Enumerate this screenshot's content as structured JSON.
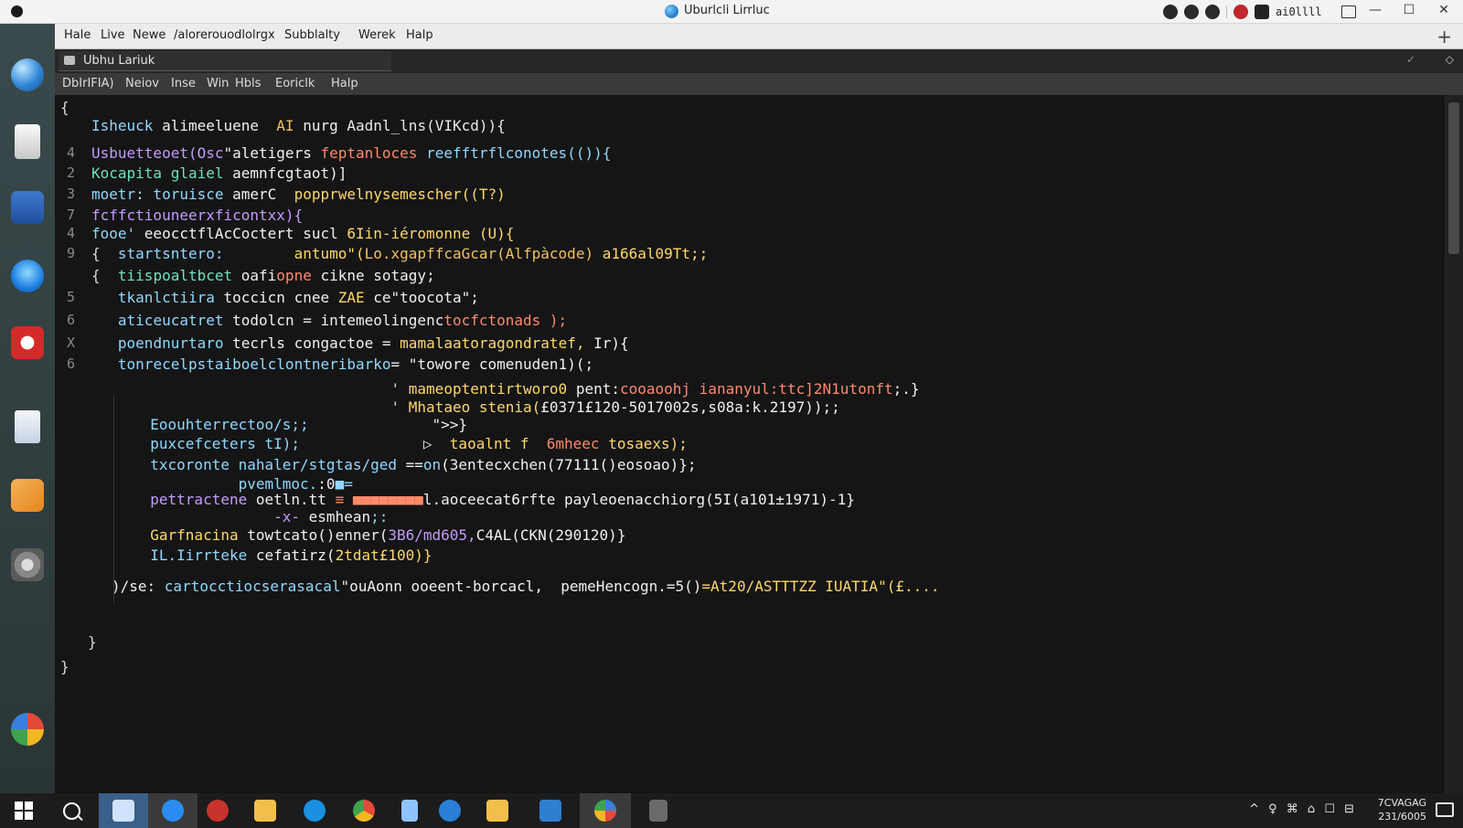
{
  "window": {
    "title": "Uburlcli Lirrluc",
    "user": "ai0llll"
  },
  "menubar": {
    "items": [
      "Hale",
      "Live",
      "Newe",
      "/alorerouodlolrgx",
      "Subblalty",
      "Werek",
      "Halp"
    ]
  },
  "tab": {
    "label": "Ubhu Lariuk"
  },
  "submenu": {
    "items": [
      "DbIrIFIA)",
      "Neiov",
      "Inse",
      "Win",
      "Hbls",
      "Eoriclk",
      "Halp"
    ]
  },
  "code": {
    "gutter": [
      "4",
      "2",
      "3",
      "7",
      "4",
      "9",
      "5",
      "6",
      "X",
      "6"
    ],
    "lines": [
      {
        "segments": [
          {
            "t": "{",
            "c": "#d8d8d8"
          }
        ]
      },
      {
        "segments": [
          {
            "t": "Ishеuсk ",
            "c": "#8fd8ff"
          },
          {
            "t": "alimeeluene  ",
            "c": "#f0f0f0"
          },
          {
            "t": "AI ",
            "c": "#f0c060"
          },
          {
            "t": "nurg ",
            "c": "#f0f0f0"
          },
          {
            "t": "Aadnl_lns(VIKcd)){",
            "c": "#e8e8e8"
          }
        ]
      },
      {
        "segments": [
          {
            "t": "Usbuetteoet(Osc",
            "c": "#c49bff"
          },
          {
            "t": "\"aletigers ",
            "c": "#f0f0f0"
          },
          {
            "t": "feptanloces ",
            "c": "#ff8a6a"
          },
          {
            "t": "reefftrflconotes(()){",
            "c": "#8fd8ff"
          }
        ]
      },
      {
        "segments": [
          {
            "t": "Kocapita glaiel ",
            "c": "#6fe0c0"
          },
          {
            "t": "aemnfcgtaot)]",
            "c": "#f0f0f0"
          }
        ]
      },
      {
        "segments": [
          {
            "t": "moetr: toruisce ",
            "c": "#8fd8ff"
          },
          {
            "t": "amerC  ",
            "c": "#f0f0f0"
          },
          {
            "t": "popprwelnysemescher((T?)",
            "c": "#ffd86a"
          }
        ]
      },
      {
        "segments": [
          {
            "t": "fcffctiouneerxficontxx){",
            "c": "#c49bff"
          }
        ]
      },
      {
        "segments": [
          {
            "t": "fooe' ",
            "c": "#8fd8ff"
          },
          {
            "t": "eeocctflAcCoctert sucl ",
            "c": "#f0f0f0"
          },
          {
            "t": "6Iin-iéromonne (U){",
            "c": "#ffd86a"
          }
        ]
      },
      {
        "segments": [
          {
            "t": "{  ",
            "c": "#d8d8d8"
          },
          {
            "t": "startsntero:        ",
            "c": "#8fd8ff"
          },
          {
            "t": "antumo\"(",
            "c": "#ffd86a"
          },
          {
            "t": "Lo.xgapffcaGcar(Alfpàcode) ",
            "c": "#f0c060"
          },
          {
            "t": "a166al09Tt;;",
            "c": "#ffd86a"
          }
        ]
      },
      {
        "segments": [
          {
            "t": "{  ",
            "c": "#d8d8d8"
          },
          {
            "t": "tiispoaltbcet ",
            "c": "#6fe0c0"
          },
          {
            "t": "oafi",
            "c": "#f0f0f0"
          },
          {
            "t": "opne ",
            "c": "#ff8a6a"
          },
          {
            "t": "cikne sotagy;",
            "c": "#f0f0f0"
          }
        ]
      },
      {
        "segments": [
          {
            "t": "   ",
            "c": "#d8d8d8"
          },
          {
            "t": "tkanlctiira ",
            "c": "#8fd8ff"
          },
          {
            "t": "toccicn cnee ",
            "c": "#f0f0f0"
          },
          {
            "t": "ZAE ",
            "c": "#ffd86a"
          },
          {
            "t": "ce\"toocota\";",
            "c": "#f0f0f0"
          }
        ]
      },
      {
        "segments": [
          {
            "t": "   ",
            "c": "#d8d8d8"
          },
          {
            "t": "aticeucatret ",
            "c": "#8fd8ff"
          },
          {
            "t": "todolcn = ",
            "c": "#f0f0f0"
          },
          {
            "t": "intemeolingenc",
            "c": "#f0f0f0"
          },
          {
            "t": "tocfctonads );",
            "c": "#ff8a6a"
          }
        ]
      },
      {
        "segments": [
          {
            "t": "   ",
            "c": "#d8d8d8"
          },
          {
            "t": "poendnurtaro ",
            "c": "#8fd8ff"
          },
          {
            "t": "tecrls congactoe = ",
            "c": "#f0f0f0"
          },
          {
            "t": "mamalaatoragondratef, ",
            "c": "#ffd86a"
          },
          {
            "t": "Ir){",
            "c": "#f0f0f0"
          }
        ]
      },
      {
        "segments": [
          {
            "t": "   ",
            "c": "#d8d8d8"
          },
          {
            "t": "tonrecelpstaiboelclontneribarko",
            "c": "#8fd8ff"
          },
          {
            "t": "= \"towore comenuden1)(;",
            "c": "#f0f0f0"
          }
        ]
      },
      {
        "segments": [
          {
            "t": "                                  ' ",
            "c": "#d8d8d8"
          },
          {
            "t": "mameoptentirtworo0 ",
            "c": "#ffd86a"
          },
          {
            "t": "pent:",
            "c": "#f0f0f0"
          },
          {
            "t": "cooaoohj iananyul:ttc]2N1utonft",
            "c": "#ff8a6a"
          },
          {
            "t": ";.}",
            "c": "#f0f0f0"
          }
        ]
      },
      {
        "segments": [
          {
            "t": "                                  ' ",
            "c": "#d8d8d8"
          },
          {
            "t": "Mhataeo stenia(",
            "c": "#ffd86a"
          },
          {
            "t": "£0371£120-5017002s,s08a:k.2197));;",
            "c": "#f0f0f0"
          }
        ]
      },
      {
        "segments": [
          {
            "t": "  ",
            "c": "#d8d8d8"
          },
          {
            "t": "Eoouhterrectoo/s;;",
            "c": "#8fd8ff"
          },
          {
            "t": "              \">>}",
            "c": "#f0f0f0"
          }
        ]
      },
      {
        "segments": [
          {
            "t": "  ",
            "c": "#d8d8d8"
          },
          {
            "t": "puxcefceters tI);",
            "c": "#8fd8ff"
          },
          {
            "t": "              ▷  ",
            "c": "#f0f0f0"
          },
          {
            "t": "taoalnt f  ",
            "c": "#ffd86a"
          },
          {
            "t": "6mheec ",
            "c": "#ff8a6a"
          },
          {
            "t": "tosaexs);",
            "c": "#ffd86a"
          }
        ]
      },
      {
        "segments": [
          {
            "t": "  ",
            "c": "#d8d8d8"
          },
          {
            "t": "txcoronte nahaler/stgtas/ged ",
            "c": "#8fd8ff"
          },
          {
            "t": "==",
            "c": "#f0f0f0"
          },
          {
            "t": "on",
            "c": "#8fd8ff"
          },
          {
            "t": "(3entecxchen(77111()eosoao)};",
            "c": "#f0f0f0"
          }
        ]
      },
      {
        "segments": [
          {
            "t": "            ",
            "c": "#d8d8d8"
          },
          {
            "t": "pvemlmoc.",
            "c": "#8fd8ff"
          },
          {
            "t": ":0",
            "c": "#f0f0f0"
          },
          {
            "t": "■=",
            "c": "#8fd8ff"
          }
        ]
      },
      {
        "segments": [
          {
            "t": "  ",
            "c": "#d8d8d8"
          },
          {
            "t": "pettractene ",
            "c": "#c49bff"
          },
          {
            "t": "oetln.tt ",
            "c": "#f0f0f0"
          },
          {
            "t": "≡ ■■■■■■■■",
            "c": "#ff8a6a"
          },
          {
            "t": "l.aoceecat6rfte payleoenacchiorg(5I(a101±1971)-1}",
            "c": "#f0f0f0"
          }
        ]
      },
      {
        "segments": [
          {
            "t": "                ",
            "c": "#d8d8d8"
          },
          {
            "t": "-x- ",
            "c": "#c49bff"
          },
          {
            "t": "esmhean",
            "c": "#f0f0f0"
          },
          {
            "t": ";:",
            "c": "#8fd8ff"
          }
        ]
      },
      {
        "segments": [
          {
            "t": "  ",
            "c": "#d8d8d8"
          },
          {
            "t": "Garfnacina ",
            "c": "#ffd86a"
          },
          {
            "t": "towtcato()enner(",
            "c": "#f0f0f0"
          },
          {
            "t": "3B6/md605,",
            "c": "#c49bff"
          },
          {
            "t": "C4AL(CKN(290120)}",
            "c": "#f0f0f0"
          }
        ]
      },
      {
        "segments": [
          {
            "t": "  ",
            "c": "#d8d8d8"
          },
          {
            "t": "IL.Iirrteke ",
            "c": "#8fd8ff"
          },
          {
            "t": "cefatirz(",
            "c": "#f0f0f0"
          },
          {
            "t": "2tdat£100)}",
            "c": "#ffd86a"
          }
        ]
      },
      {
        "segments": [
          {
            "t": ")/se: ",
            "c": "#f0f0f0"
          },
          {
            "t": "cartocctiocserasacal",
            "c": "#8fd8ff"
          },
          {
            "t": "\"ouAonn ooeent-borcacl,  pemeHencogn.=5()",
            "c": "#f0f0f0"
          },
          {
            "t": "=At20/ASTTTZZ IUATIA\"(£....",
            "c": "#ffd86a"
          }
        ]
      },
      {
        "segments": [
          {
            "t": "}",
            "c": "#d8d8d8"
          }
        ]
      },
      {
        "segments": [
          {
            "t": "}",
            "c": "#d8d8d8"
          }
        ]
      }
    ]
  },
  "taskbar": {
    "tray": "^ ♀ ⌘ ⌂ ☐ ⊟",
    "clock_time": "7CVAGAG",
    "clock_date": "231/6005"
  },
  "icons": [
    "globe-icon",
    "server-icon",
    "mail-icon",
    "chat-icon",
    "camera-icon",
    "document-icon",
    "play-icon",
    "disk-icon",
    "apps-icon",
    "windows-icon",
    "search-icon",
    "folder-icon",
    "edge-icon",
    "chrome-icon",
    "file-icon",
    "store-icon",
    "calendar-icon"
  ]
}
